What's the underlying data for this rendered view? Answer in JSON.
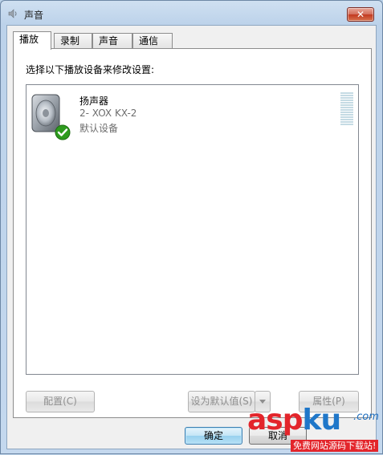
{
  "window": {
    "title": "声音",
    "close_label": "✕"
  },
  "tabs": [
    {
      "label": "播放",
      "active": true
    },
    {
      "label": "录制",
      "active": false
    },
    {
      "label": "声音",
      "active": false
    },
    {
      "label": "通信",
      "active": false
    }
  ],
  "panel": {
    "instruction": "选择以下播放设备来修改设置:"
  },
  "devices": [
    {
      "name": "扬声器",
      "description": "2- XOX KX-2",
      "status": "默认设备",
      "icon": "speaker-icon",
      "default_check_icon": "check-icon"
    }
  ],
  "buttons": {
    "configure": "配置(C)",
    "set_default": "设为默认值(S)",
    "properties": "属性(P)",
    "ok": "确定",
    "cancel": "取消"
  },
  "watermark": {
    "brand_a": "asp",
    "brand_b": "ku",
    "domain": ".com",
    "tagline": "免费网站源码下载站!"
  },
  "colors": {
    "accent": "#3c7fb1",
    "check": "#2e9b1e",
    "level_meter": "#c5dbe4",
    "watermark_red": "#e3252b"
  }
}
